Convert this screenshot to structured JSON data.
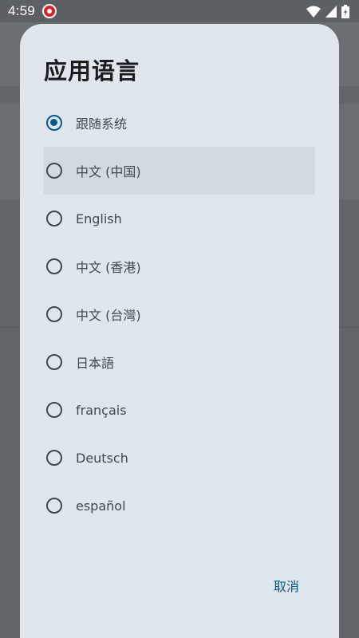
{
  "status_bar": {
    "time": "4:59",
    "icons": [
      "app-notification-icon",
      "wifi-icon",
      "cell-signal-icon",
      "battery-icon"
    ]
  },
  "dialog": {
    "title": "应用语言",
    "options": [
      {
        "label": "跟随系统",
        "selected": true
      },
      {
        "label": "中文 (中国)",
        "selected": false,
        "highlighted": true
      },
      {
        "label": "English",
        "selected": false
      },
      {
        "label": "中文 (香港)",
        "selected": false
      },
      {
        "label": "中文 (台灣)",
        "selected": false
      },
      {
        "label": "日本語",
        "selected": false
      },
      {
        "label": "français",
        "selected": false
      },
      {
        "label": "Deutsch",
        "selected": false
      },
      {
        "label": "español",
        "selected": false
      }
    ],
    "cancel_label": "取消"
  },
  "colors": {
    "accent": "#075a86",
    "dialog_bg": "#dfe6ee",
    "highlight_row": "#d2d9e0",
    "text": "#43474e",
    "scrim": "#626669"
  }
}
